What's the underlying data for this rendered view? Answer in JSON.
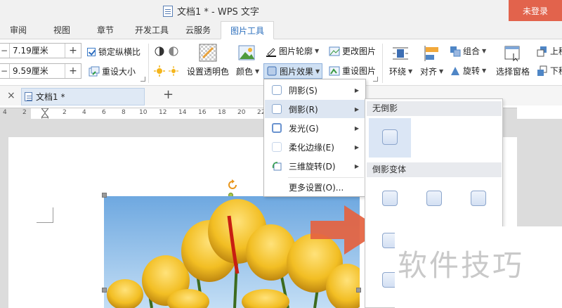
{
  "window": {
    "title": "文档1 * - WPS 文字",
    "login_button": "未登录"
  },
  "ribbon_tabs": {
    "review": "审阅",
    "view": "视图",
    "chapter": "章节",
    "dev_tools": "开发工具",
    "cloud": "云服务",
    "picture_tools": "图片工具"
  },
  "ribbon": {
    "width_value": "7.19厘米",
    "height_value": "9.59厘米",
    "lock_aspect": "锁定纵横比",
    "reset_size": "重设大小",
    "set_transparent": "设置透明色",
    "color": "颜色",
    "outline": "图片轮廓",
    "effects": "图片效果",
    "change_picture": "更改图片",
    "reset_picture": "重设图片",
    "wrap": "环绕",
    "align": "对齐",
    "group": "组合",
    "rotate": "旋转",
    "selection_pane": "选择窗格",
    "bring_forward": "上移",
    "send_backward": "下移",
    "minus": "−",
    "plus": "+"
  },
  "doc_tabs": {
    "close": "×",
    "name": "文档1 *",
    "new": "+"
  },
  "ruler_numbers": [
    "4",
    "2",
    "2",
    "4",
    "6",
    "8",
    "10",
    "12",
    "14",
    "16",
    "18",
    "20",
    "22"
  ],
  "effects_menu": {
    "shadow": "阴影(S)",
    "reflection": "倒影(R)",
    "glow": "发光(G)",
    "soft_edges": "柔化边缘(E)",
    "rotation_3d": "三维旋转(D)",
    "more": "更多设置(O)..."
  },
  "reflection_submenu": {
    "none_header": "无倒影",
    "variants_header": "倒影变体"
  },
  "watermark": "软件技巧",
  "colors": {
    "accent": "#2c6fbd",
    "login_bg": "#e2634c",
    "highlight": "#dde6f2",
    "arrow": "#e5623f"
  }
}
